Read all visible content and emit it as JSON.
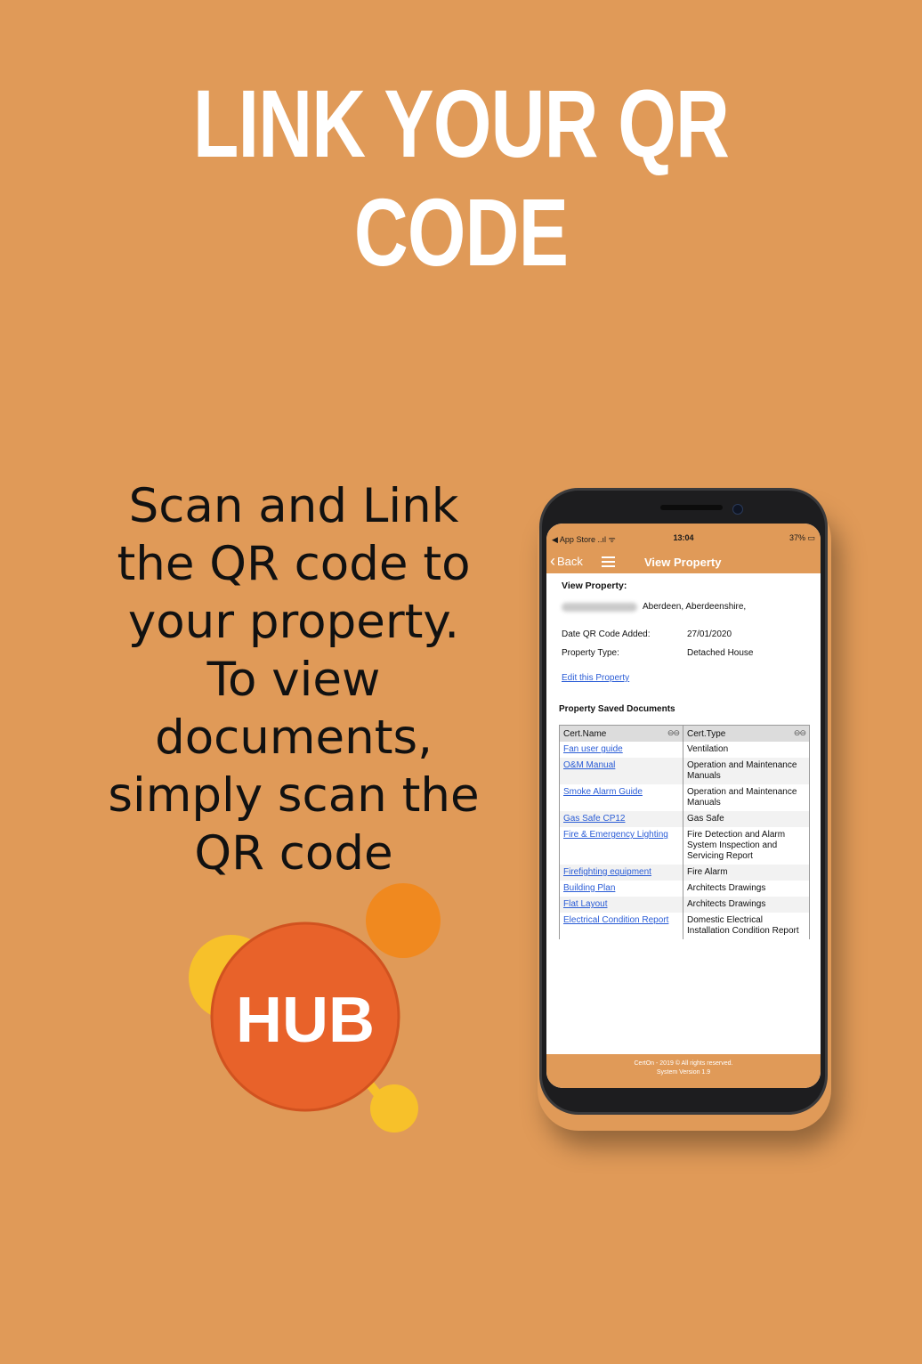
{
  "headline": [
    "LINK YOUR QR",
    "CODE"
  ],
  "body_text": [
    "Scan and Link",
    "the QR code to",
    "your property.",
    "To view",
    "documents,",
    "simply scan the",
    "QR code"
  ],
  "logo": {
    "text": "HUB"
  },
  "colors": {
    "background": "#e09a58",
    "logo_primary": "#e8622a",
    "logo_secondary": "#f0891f",
    "logo_accent": "#f7c12a"
  },
  "phone": {
    "statusbar": {
      "left": "◀ App Store ..ıl ᯤ",
      "time": "13:04",
      "battery": "37% ▭"
    },
    "navbar": {
      "back_label": "Back",
      "back_icon": "chevron-left-icon",
      "menu_icon": "hamburger-icon",
      "title": "View Property"
    },
    "content": {
      "view_label": "View Property:",
      "address_visible": "Aberdeen, Aberdeenshire,",
      "date_label": "Date QR Code Added:",
      "date_value": "27/01/2020",
      "type_label": "Property Type:",
      "type_value": "Detached House",
      "edit_link": "Edit this Property",
      "saved_title": "Property Saved Documents",
      "table": {
        "headers": [
          "Cert.Name",
          "Cert.Type"
        ],
        "sort_icon": "⊖⊖",
        "rows": [
          {
            "name": "Fan user guide",
            "type": "Ventilation"
          },
          {
            "name": "O&M Manual",
            "type": "Operation and Maintenance Manuals"
          },
          {
            "name": "Smoke Alarm Guide",
            "type": "Operation and Maintenance Manuals"
          },
          {
            "name": "Gas Safe CP12",
            "type": "Gas Safe"
          },
          {
            "name": "Fire & Emergency Lighting",
            "type": "Fire Detection and Alarm System Inspection and Servicing Report"
          },
          {
            "name": "Firefighting equipment",
            "type": "Fire Alarm"
          },
          {
            "name": "Building Plan",
            "type": "Architects Drawings"
          },
          {
            "name": "Flat Layout",
            "type": "Architects Drawings"
          },
          {
            "name": "Electrical Condition Report",
            "type": "Domestic Electrical Installation Condition Report"
          }
        ]
      }
    },
    "footer": {
      "line1": "CertOn - 2019 © All rights reserved.",
      "line2": "System Version 1.9"
    }
  }
}
